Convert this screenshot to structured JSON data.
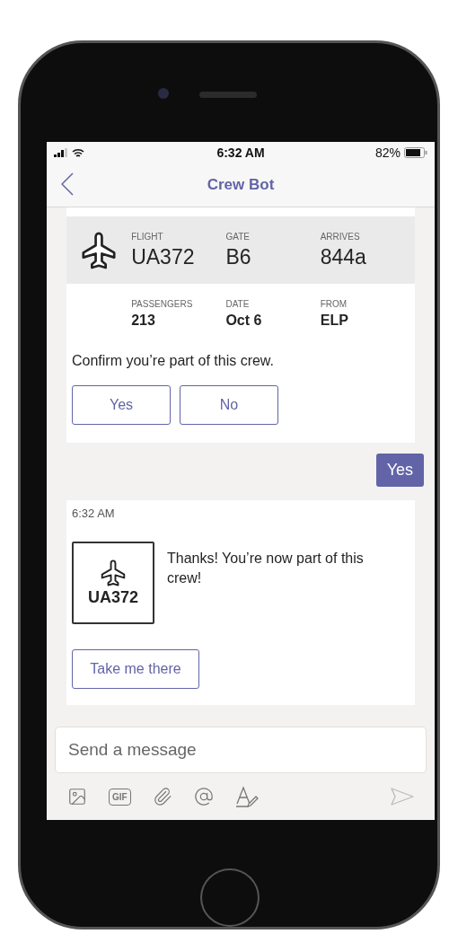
{
  "status_bar": {
    "time": "6:32 AM",
    "battery": "82%"
  },
  "header": {
    "title": "Crew Bot"
  },
  "flight_card": {
    "primary": [
      {
        "label": "FLIGHT",
        "value": "UA372"
      },
      {
        "label": "GATE",
        "value": "B6"
      },
      {
        "label": "ARRIVES",
        "value": "844a"
      }
    ],
    "secondary": [
      {
        "label": "PASSENGERS",
        "value": "213"
      },
      {
        "label": "DATE",
        "value": "Oct 6"
      },
      {
        "label": "FROM",
        "value": "ELP"
      }
    ],
    "prompt": "Confirm you’re part of this crew.",
    "buttons": [
      "Yes",
      "No"
    ]
  },
  "sent_message": {
    "text": "Yes"
  },
  "bot_message": {
    "time": "6:32 AM",
    "tile_label": "UA372",
    "text": "Thanks! You’re now part of this crew!",
    "button": "Take me there"
  },
  "composer": {
    "placeholder": "Send a message",
    "gif_label": "GIF"
  }
}
